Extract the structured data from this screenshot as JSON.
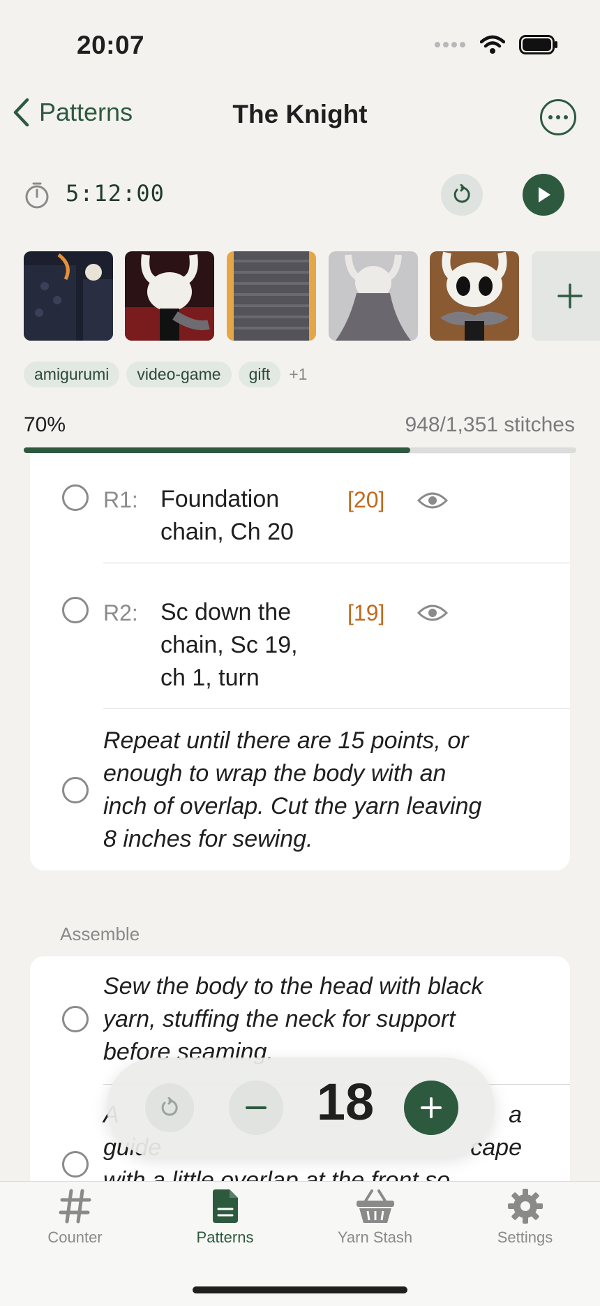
{
  "status_bar": {
    "time": "20:07"
  },
  "nav": {
    "back_label": "Patterns",
    "title": "The Knight"
  },
  "timer": {
    "value": "5:12:00"
  },
  "photos": [
    "photo-1",
    "photo-2",
    "photo-3",
    "photo-4",
    "photo-5"
  ],
  "tags": {
    "items": [
      "amigurumi",
      "video-game",
      "gift"
    ],
    "more": "+1"
  },
  "progress": {
    "percent_label": "70%",
    "stitches_label": "948/1,351 stitches",
    "fraction": 0.7
  },
  "rows": [
    {
      "label": "R1:",
      "text_lines": [
        "Foundation",
        "chain, Ch 20"
      ],
      "count": "[20]"
    },
    {
      "label": "R2:",
      "text_lines": [
        "Sc down the",
        "chain, Sc 19,",
        "ch 1, turn"
      ],
      "count": "[19]"
    }
  ],
  "note": {
    "lines": [
      "Repeat until there are 15 points, or",
      "enough to wrap the body with an",
      "inch of overlap. Cut the yarn leaving",
      "8 inches for sewing."
    ]
  },
  "assemble": {
    "header": "Assemble",
    "step1_lines": [
      "Sew the body to the head with black",
      "yarn, stuffing the neck for support",
      "before seaming."
    ],
    "step2_lines": [
      "A",
      "a",
      "guide",
      "cape",
      "with a little overlap at the front so"
    ]
  },
  "counter": {
    "value": "18"
  },
  "tabs": [
    {
      "label": "Counter",
      "icon": "hash-icon"
    },
    {
      "label": "Patterns",
      "icon": "document-icon"
    },
    {
      "label": "Yarn Stash",
      "icon": "basket-icon"
    },
    {
      "label": "Settings",
      "icon": "gear-icon"
    }
  ],
  "colors": {
    "accent": "#2d5a3f",
    "count": "#c06a1f",
    "background": "#f3f2ef"
  }
}
